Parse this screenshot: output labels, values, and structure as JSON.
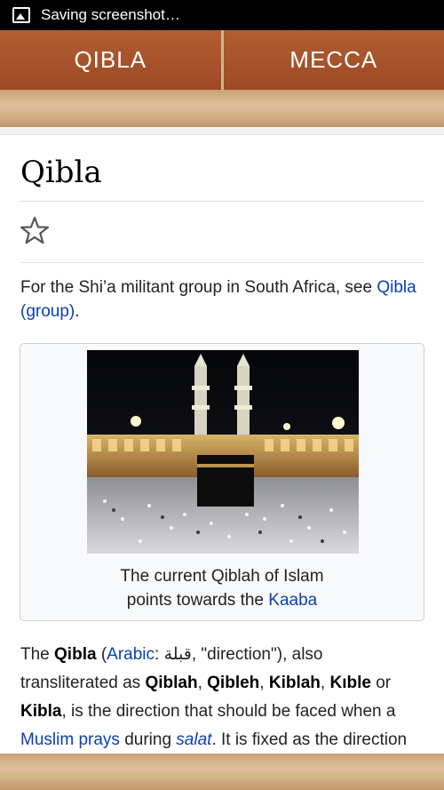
{
  "status_bar": {
    "notification_text": "Saving screenshot…",
    "icon": "image-icon"
  },
  "tabs": [
    {
      "label": "QIBLA"
    },
    {
      "label": "MECCA"
    }
  ],
  "article": {
    "title": "Qibla",
    "star_icon": "star-outline-icon",
    "hatnote": {
      "prefix": "For the Shi’a militant group in South Africa, see ",
      "link": "Qibla (group)",
      "suffix": "."
    },
    "figure": {
      "caption_line1": "The current Qiblah of Islam",
      "caption_line2_prefix": "points towards the ",
      "caption_link": "Kaaba"
    },
    "paragraph": {
      "t1": "The ",
      "b_qibla": "Qibla",
      "t2": " (",
      "link_arabic": "Arabic",
      "t3": ": ",
      "arabic": "قبلة",
      "t4": ", \"direction\"), also transliterated as ",
      "b_qiblah": "Qiblah",
      "t5": ", ",
      "b_qibleh": "Qibleh",
      "t6": ", ",
      "b_kiblah": "Kiblah",
      "t7": ", ",
      "b_kible": "Kıble",
      "t8": " or ",
      "b_kibla": "Kibla",
      "t9": ", is the direction that should be faced when a ",
      "link_muslim": "Muslim",
      "t10": " ",
      "link_prays": "prays",
      "t11": " during ",
      "link_salat": "salat",
      "t12": ". It is fixed as the direction"
    }
  }
}
